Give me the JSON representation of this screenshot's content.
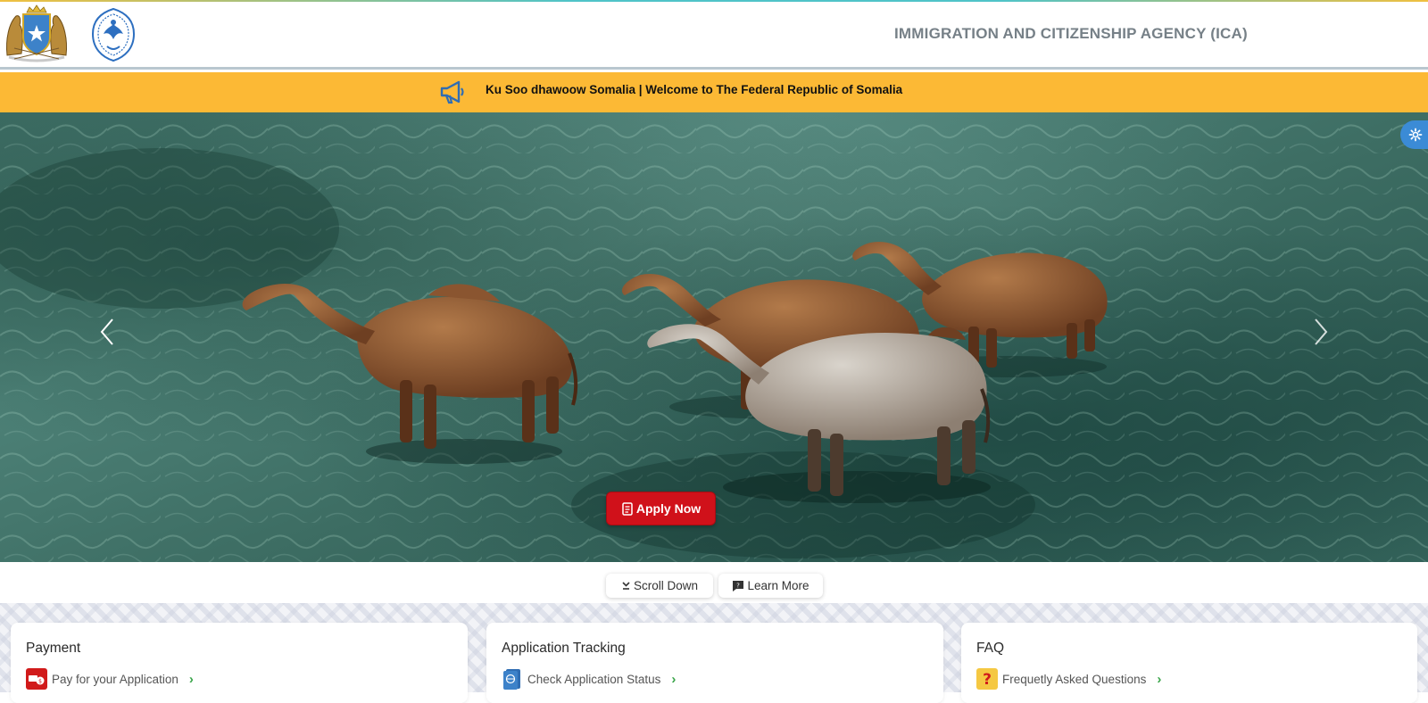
{
  "header": {
    "agency_title": "IMMIGRATION AND CITIZENSHIP AGENCY (ICA)",
    "emblem_icon": "somalia-coat-of-arms",
    "logo_icon": "ica-eagle-logo"
  },
  "banner": {
    "icon": "megaphone-icon",
    "text": "Ku Soo dhawoow Somalia | Welcome to The Federal Republic of Somalia",
    "color": "#fcb935"
  },
  "hero": {
    "image_description": "camels wading through clear green water",
    "prev_icon": "chevron-left-icon",
    "next_icon": "chevron-right-icon",
    "apply_label": "Apply Now",
    "apply_color": "#d0111a"
  },
  "settings": {
    "icon": "gear-icon",
    "color": "#3b8bd6"
  },
  "actions": {
    "scroll_label": "Scroll Down",
    "learn_label": "Learn More"
  },
  "cards": [
    {
      "title": "Payment",
      "link": "Pay for your Application",
      "icon": "payment-icon"
    },
    {
      "title": "Application Tracking",
      "link": "Check Application Status",
      "icon": "passport-icon"
    },
    {
      "title": "FAQ",
      "link": "Frequetly Asked Questions",
      "icon": "question-icon"
    }
  ]
}
